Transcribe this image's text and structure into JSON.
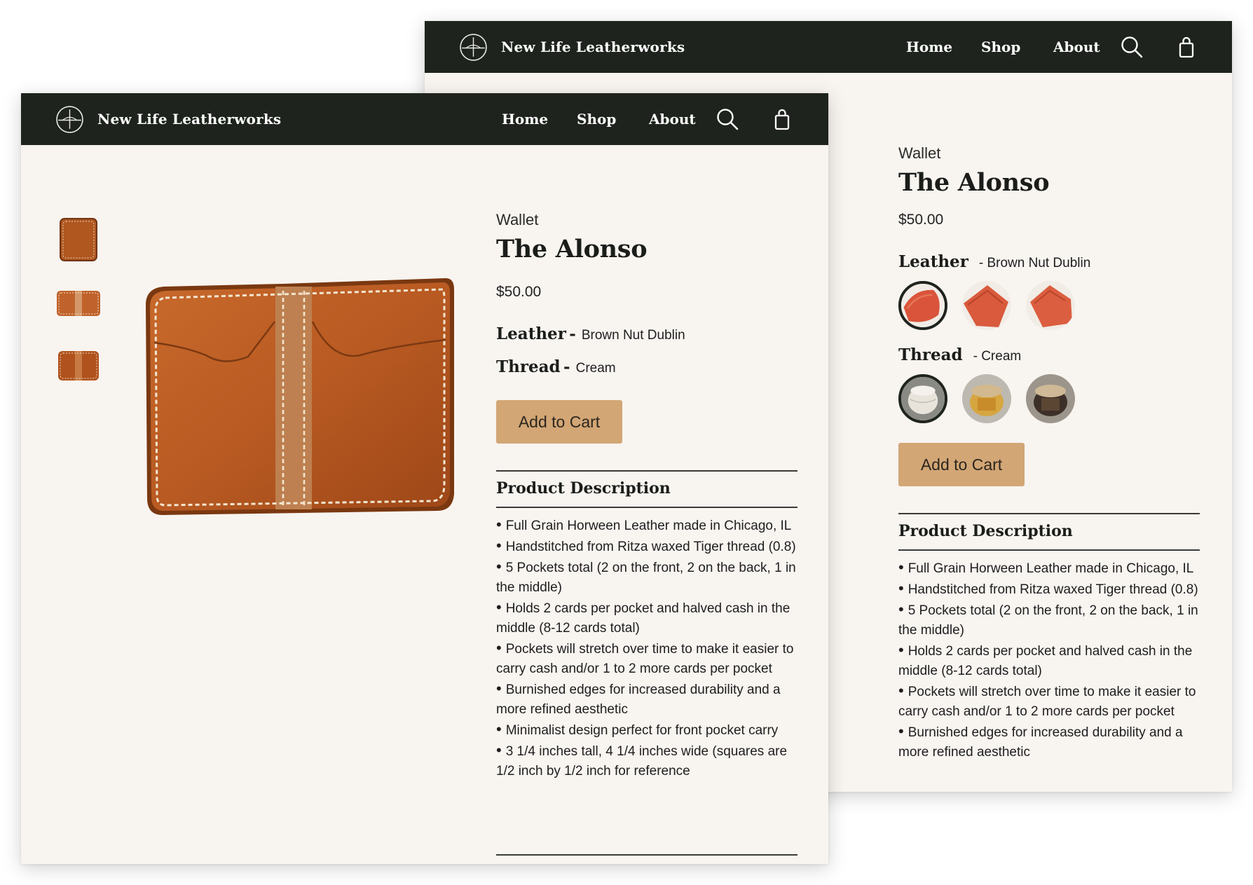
{
  "brand": {
    "name": "New Life Leatherworks"
  },
  "nav": {
    "home": "Home",
    "shop": "Shop",
    "about": "About"
  },
  "product": {
    "category": "Wallet",
    "title": "The Alonso",
    "price": "$50.00",
    "leather_label": "Leather",
    "leather_value": "Brown Nut Dublin",
    "thread_label": "Thread",
    "thread_value": "Cream",
    "add_to_cart": "Add to Cart",
    "description_heading": "Product Description",
    "description_items": [
      "Full Grain Horween Leather made in Chicago, IL",
      "Handstitched from Ritza waxed Tiger thread (0.8)",
      "5 Pockets total (2 on the front, 2 on the back, 1 in the middle)",
      "Holds 2 cards per pocket and halved cash in the middle (8-12 cards total)",
      "Pockets will stretch over time to make it easier to carry cash and/or 1 to 2 more cards per pocket",
      "Burnished edges for increased durability and a more refined aesthetic",
      "Minimalist design perfect for front pocket carry",
      "3 1/4 inches tall, 4 1/4 inches wide (squares are 1/2 inch by 1/2 inch for reference"
    ]
  },
  "leather_swatches": [
    {
      "name": "leather-swatch-1",
      "color": "#d9543a",
      "selected": true
    },
    {
      "name": "leather-swatch-2",
      "color": "#d95a3c",
      "selected": false
    },
    {
      "name": "leather-swatch-3",
      "color": "#dc5e40",
      "selected": false
    }
  ],
  "thread_swatches": [
    {
      "name": "thread-swatch-cream",
      "color": "#e8e4dc",
      "selected": true
    },
    {
      "name": "thread-swatch-gold",
      "color": "#d6a640",
      "selected": false
    },
    {
      "name": "thread-swatch-dark",
      "color": "#5b4634",
      "selected": false
    }
  ],
  "colors": {
    "navbar": "#1e231d",
    "page_bg": "#f8f4f0",
    "button": "#d2a675",
    "leather": "#b9632b"
  }
}
